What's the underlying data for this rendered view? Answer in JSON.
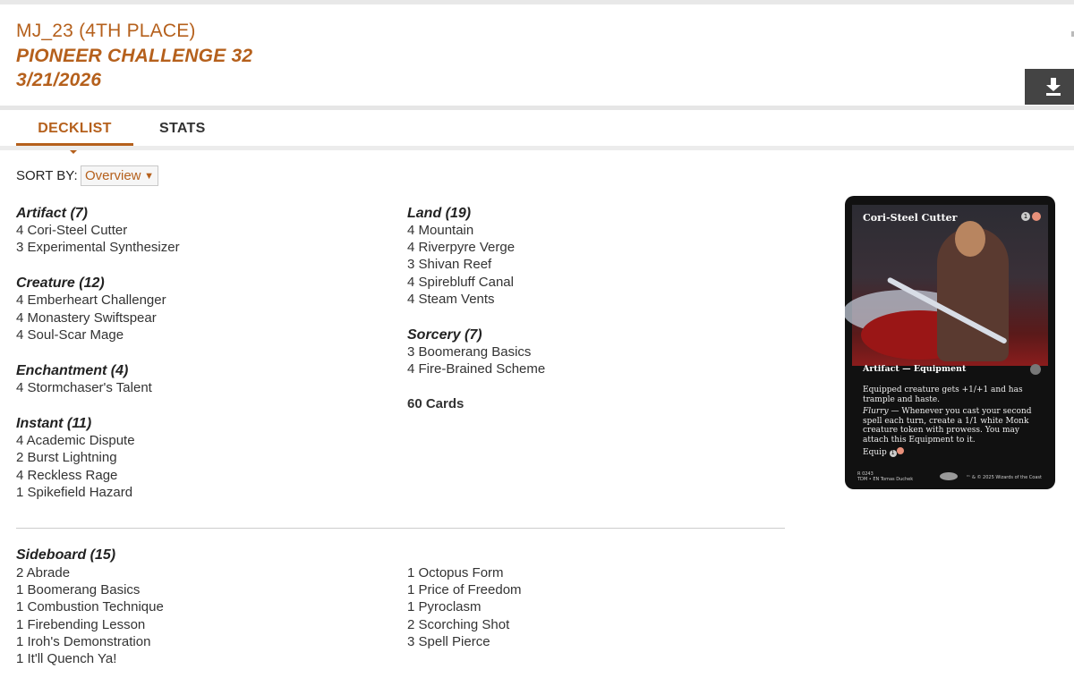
{
  "header": {
    "title": "MJ_23 (4TH PLACE)",
    "event": "PIONEER CHALLENGE 32",
    "date": "3/21/2026",
    "download_icon": "download-icon"
  },
  "tabs": [
    {
      "label": "DECKLIST",
      "active": true
    },
    {
      "label": "STATS",
      "active": false
    }
  ],
  "sort": {
    "label": "SORT BY:",
    "value": "Overview"
  },
  "main_deck": {
    "left": [
      {
        "title": "Artifact (7)",
        "cards": [
          "4 Cori-Steel Cutter",
          "3 Experimental Synthesizer"
        ]
      },
      {
        "title": "Creature (12)",
        "cards": [
          "4 Emberheart Challenger",
          "4 Monastery Swiftspear",
          "4 Soul-Scar Mage"
        ]
      },
      {
        "title": "Enchantment (4)",
        "cards": [
          "4 Stormchaser's Talent"
        ]
      },
      {
        "title": "Instant (11)",
        "cards": [
          "4 Academic Dispute",
          "2 Burst Lightning",
          "4 Reckless Rage",
          "1 Spikefield Hazard"
        ]
      }
    ],
    "right": [
      {
        "title": "Land (19)",
        "cards": [
          "4 Mountain",
          "4 Riverpyre Verge",
          "3 Shivan Reef",
          "4 Spirebluff Canal",
          "4 Steam Vents"
        ]
      },
      {
        "title": "Sorcery (7)",
        "cards": [
          "3 Boomerang Basics",
          "4 Fire-Brained Scheme"
        ]
      }
    ],
    "total": "60 Cards"
  },
  "sideboard": {
    "title": "Sideboard (15)",
    "left": [
      "2 Abrade",
      "1 Boomerang Basics",
      "1 Combustion Technique",
      "1 Firebending Lesson",
      "1 Iroh's Demonstration",
      "1 It'll Quench Ya!"
    ],
    "right": [
      "1 Octopus Form",
      "1 Price of Freedom",
      "1 Pyroclasm",
      "2 Scorching Shot",
      "3 Spell Pierce"
    ]
  },
  "card_preview": {
    "name": "Cori-Steel Cutter",
    "cost": [
      "1",
      "R"
    ],
    "type_line": "Artifact — Equipment",
    "rules_1": "Equipped creature gets +1/+1 and has trample and haste.",
    "rules_2_keyword": "Flurry",
    "rules_2": " — Whenever you cast your second spell each turn, create a 1/1 white Monk creature token with prowess. You may attach this Equipment to it.",
    "rules_3": "Equip",
    "collector": "R 0243",
    "set_line": "TDM • EN",
    "artist": "Tomas Duchek",
    "copyright": "™ & © 2025 Wizards of the Coast"
  },
  "colors": {
    "accent": "#b5601c",
    "download_bg": "#444444"
  }
}
